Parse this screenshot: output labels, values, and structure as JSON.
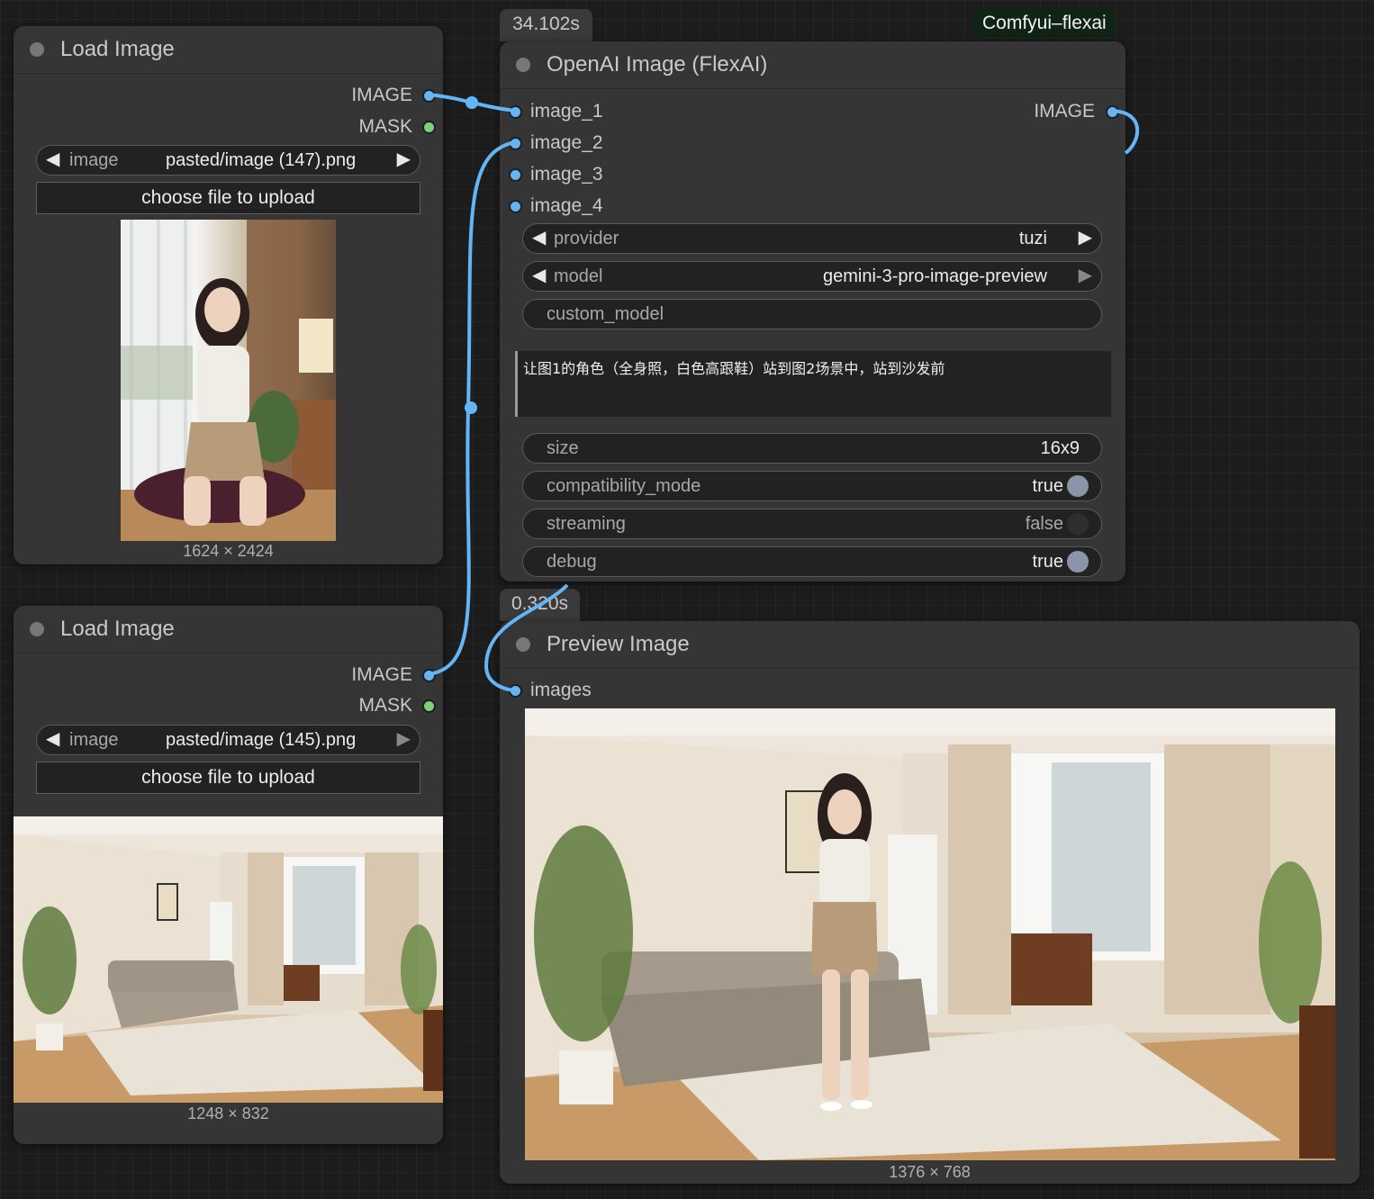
{
  "canvas": {
    "group_tag": "Comfyui–flexai"
  },
  "load_image_1": {
    "title": "Load Image",
    "outputs": [
      "IMAGE",
      "MASK"
    ],
    "widget_name": "image",
    "widget_value": "pasted/image (147).png",
    "upload_label": "choose file to upload",
    "image_dims": "1624 × 2424",
    "image_alt": "portrait of a woman sitting on a cushion by a window"
  },
  "load_image_2": {
    "title": "Load Image",
    "outputs": [
      "IMAGE",
      "MASK"
    ],
    "widget_name": "image",
    "widget_value": "pasted/image (145).png",
    "upload_label": "choose file to upload",
    "image_dims": "1248 × 832",
    "image_alt": "living room with grey sofa and large windows"
  },
  "openai_node": {
    "timing": "34.102s",
    "title": "OpenAI Image (FlexAI)",
    "inputs": [
      "image_1",
      "image_2",
      "image_3",
      "image_4"
    ],
    "output": "IMAGE",
    "provider": {
      "name": "provider",
      "value": "tuzi"
    },
    "model": {
      "name": "model",
      "value": "gemini-3-pro-image-preview"
    },
    "custom_model": {
      "name": "custom_model"
    },
    "prompt": "让图1的角色（全身照，白色高跟鞋）站到图2场景中，站到沙发前",
    "size": {
      "name": "size",
      "value": "16x9"
    },
    "compatibility_mode": {
      "name": "compatibility_mode",
      "value": "true"
    },
    "streaming": {
      "name": "streaming",
      "value": "false"
    },
    "debug": {
      "name": "debug",
      "value": "true"
    }
  },
  "preview_node": {
    "timing": "0.320s",
    "title": "Preview Image",
    "input": "images",
    "image_dims": "1376 × 768",
    "image_alt": "woman standing in front of grey sofa in living room"
  }
}
